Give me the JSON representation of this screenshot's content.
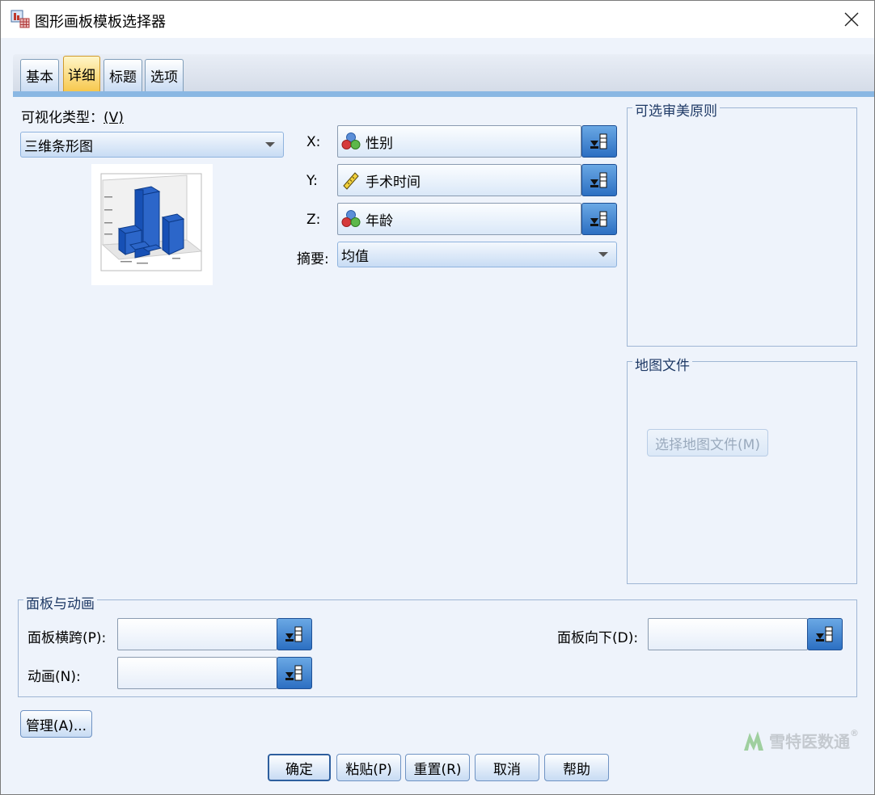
{
  "window": {
    "title": "图形画板模板选择器"
  },
  "tabs": [
    {
      "label": "基本",
      "active": false
    },
    {
      "label": "详细",
      "active": true
    },
    {
      "label": "标题",
      "active": false
    },
    {
      "label": "选项",
      "active": false
    }
  ],
  "detail": {
    "viz_type_label": "可视化类型：",
    "viz_type_mnemonic": "(V)",
    "viz_type_value": "三维条形图",
    "x_label": "X:",
    "x_value": "性别",
    "y_label": "Y:",
    "y_value": "手术时间",
    "z_label": "Z:",
    "z_value": "年龄",
    "summary_label": "摘要:",
    "summary_value": "均值"
  },
  "aesthetics_group": {
    "title": "可选审美原则"
  },
  "map_group": {
    "title": "地图文件",
    "select_button": "选择地图文件(M)"
  },
  "panel_group": {
    "title": "面板与动画",
    "panel_across_label": "面板横跨(P):",
    "panel_across_value": "",
    "panel_down_label": "面板向下(D):",
    "panel_down_value": "",
    "animation_label": "动画(N):",
    "animation_value": ""
  },
  "manage_button": "管理(A)...",
  "buttons": {
    "ok": "确定",
    "paste": "粘贴(P)",
    "reset": "重置(R)",
    "cancel": "取消",
    "help": "帮助"
  },
  "watermark": {
    "text": "雪特医数通",
    "mark": "®"
  },
  "icons": {
    "nominal": "nominal-variable-icon",
    "scale": "scale-variable-icon",
    "picker": "variable-picker-icon"
  }
}
